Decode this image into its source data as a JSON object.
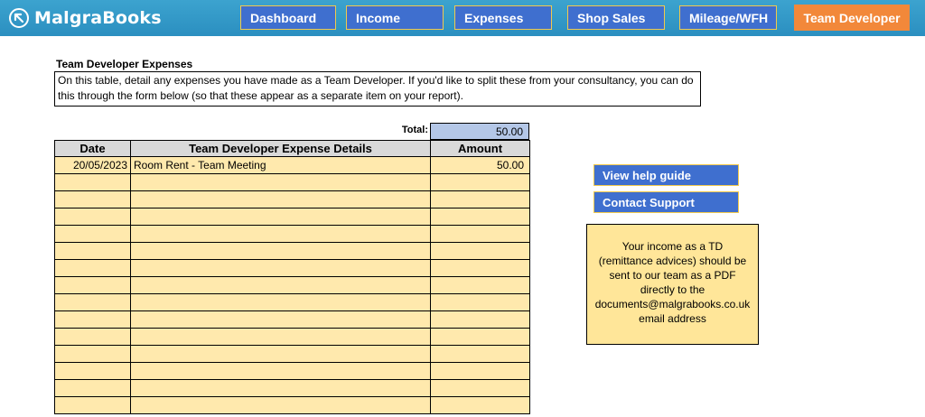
{
  "brand": {
    "name": "MalgraBooks"
  },
  "nav": [
    {
      "label": "Dashboard",
      "active": false
    },
    {
      "label": "Income",
      "active": false
    },
    {
      "label": "Expenses",
      "active": false
    },
    {
      "label": "Shop Sales",
      "active": false
    },
    {
      "label": "Mileage/WFH",
      "active": false
    },
    {
      "label": "Team Developer",
      "active": true
    }
  ],
  "page": {
    "title": "Team Developer Expenses",
    "description": "On this table, detail any expenses you have made as a Team Developer. If you'd like to split these from your consultancy, you can do this through the form below (so that these appear as a separate item on your report)."
  },
  "table": {
    "total_label": "Total:",
    "total_value": "50.00",
    "headers": [
      "Date",
      "Team Developer Expense Details",
      "Amount"
    ],
    "rows": [
      [
        "20/05/2023",
        "Room Rent - Team Meeting",
        "50.00"
      ],
      [
        "",
        "",
        ""
      ],
      [
        "",
        "",
        ""
      ],
      [
        "",
        "",
        ""
      ],
      [
        "",
        "",
        ""
      ],
      [
        "",
        "",
        ""
      ],
      [
        "",
        "",
        ""
      ],
      [
        "",
        "",
        ""
      ],
      [
        "",
        "",
        ""
      ],
      [
        "",
        "",
        ""
      ],
      [
        "",
        "",
        ""
      ],
      [
        "",
        "",
        ""
      ],
      [
        "",
        "",
        ""
      ],
      [
        "",
        "",
        ""
      ],
      [
        "",
        "",
        ""
      ]
    ]
  },
  "sidebar": {
    "help_label": "View help guide",
    "support_label": "Contact Support",
    "info_lines": [
      "Your income as a TD",
      "(remittance advices) should be",
      "sent to our team as a PDF",
      "directly to the",
      "documents@malgrabooks.co.uk",
      "email address"
    ]
  },
  "colors": {
    "topbar": "#2b8fc0",
    "nav_button": "#3f6fcf",
    "nav_active": "#f2883a",
    "cell_fill": "#ffe9ad",
    "total_fill": "#b4c7e7",
    "info_fill": "#ffe699"
  }
}
